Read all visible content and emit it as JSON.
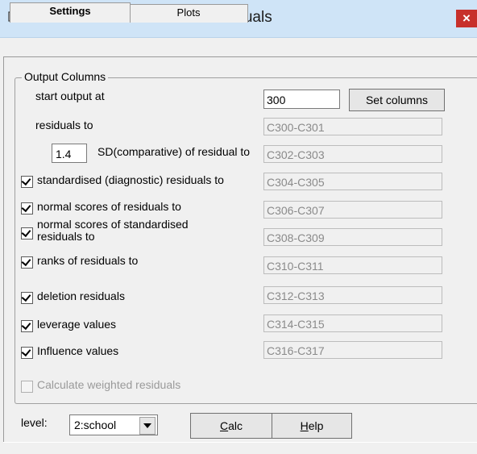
{
  "window": {
    "title": "Residuals",
    "close": "×"
  },
  "tabs": [
    {
      "label": "Settings",
      "active": true
    },
    {
      "label": "Plots",
      "active": false
    }
  ],
  "output_columns": {
    "legend": "Output Columns",
    "start_label": "start output at",
    "start_value": "300",
    "set_columns_label": "Set columns",
    "residuals_label": "residuals to",
    "residuals_cols": "C300-C301",
    "sd_value": "1.4",
    "sd_label": "SD(comparative) of residual to",
    "sd_cols": "C302-C303",
    "items": [
      {
        "label": "standardised (diagnostic) residuals to",
        "cols": "C304-C305",
        "checked": true
      },
      {
        "label": "normal scores of residuals to",
        "cols": "C306-C307",
        "checked": true
      },
      {
        "label": "normal scores of standardised residuals to",
        "cols": "C308-C309",
        "checked": true
      },
      {
        "label": "ranks of residuals to",
        "cols": "C310-C311",
        "checked": true
      },
      {
        "label": "deletion residuals",
        "cols": "C312-C313",
        "checked": true
      },
      {
        "label": "leverage values",
        "cols": "C314-C315",
        "checked": true
      },
      {
        "label": "Influence values",
        "cols": "C316-C317",
        "checked": true
      }
    ],
    "weighted_label": "Calculate weighted residuals",
    "weighted_checked": false
  },
  "footer": {
    "level_label": "level:",
    "level_value": "2:school",
    "calc_label": "Calc",
    "help_label": "Help"
  }
}
